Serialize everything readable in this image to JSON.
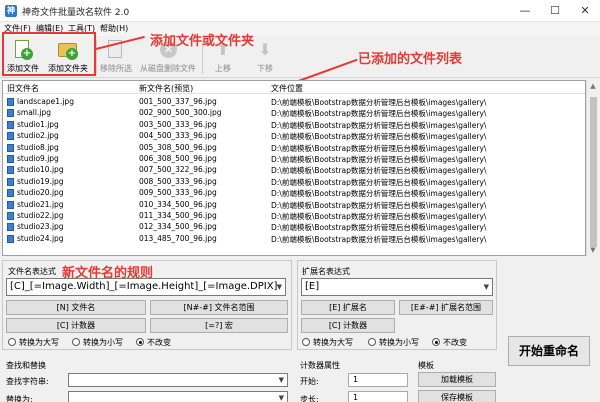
{
  "window": {
    "title": "神奇文件批量改名软件 2.0",
    "app_icon": "神",
    "min_glyph": "—",
    "max_glyph": "☐",
    "close_glyph": "✕"
  },
  "menu": [
    "文件(F)",
    "编辑(E)",
    "工具(T)",
    "帮助(H)"
  ],
  "toolbar": {
    "add_file": "添加文件",
    "add_folder": "添加文件夹",
    "remove_selected": "移除所选",
    "delete_from_disk": "从磁盘删除文件",
    "move_up": "上移",
    "move_down": "下移"
  },
  "annotations": {
    "toolbar_note": "添加文件或文件夹",
    "list_note": "已添加的文件列表",
    "rule_note": "新文件名的规则"
  },
  "file_list": {
    "columns": [
      "旧文件名",
      "新文件名(预览)",
      "文件位置"
    ],
    "rows": [
      [
        "landscape1.jpg",
        "001_500_337_96.jpg",
        "D:\\前端模板\\Bootstrap数据分析管理后台模板\\images\\gallery\\"
      ],
      [
        "small.jpg",
        "002_900_500_300.jpg",
        "D:\\前端模板\\Bootstrap数据分析管理后台模板\\images\\gallery\\"
      ],
      [
        "studio1.jpg",
        "003_500_333_96.jpg",
        "D:\\前端模板\\Bootstrap数据分析管理后台模板\\images\\gallery\\"
      ],
      [
        "studio2.jpg",
        "004_500_333_96.jpg",
        "D:\\前端模板\\Bootstrap数据分析管理后台模板\\images\\gallery\\"
      ],
      [
        "studio8.jpg",
        "005_308_500_96.jpg",
        "D:\\前端模板\\Bootstrap数据分析管理后台模板\\images\\gallery\\"
      ],
      [
        "studio9.jpg",
        "006_308_500_96.jpg",
        "D:\\前端模板\\Bootstrap数据分析管理后台模板\\images\\gallery\\"
      ],
      [
        "studio10.jpg",
        "007_500_322_96.jpg",
        "D:\\前端模板\\Bootstrap数据分析管理后台模板\\images\\gallery\\"
      ],
      [
        "studio19.jpg",
        "008_500_333_96.jpg",
        "D:\\前端模板\\Bootstrap数据分析管理后台模板\\images\\gallery\\"
      ],
      [
        "studio20.jpg",
        "009_500_333_96.jpg",
        "D:\\前端模板\\Bootstrap数据分析管理后台模板\\images\\gallery\\"
      ],
      [
        "studio21.jpg",
        "010_334_500_96.jpg",
        "D:\\前端模板\\Bootstrap数据分析管理后台模板\\images\\gallery\\"
      ],
      [
        "studio22.jpg",
        "011_334_500_96.jpg",
        "D:\\前端模板\\Bootstrap数据分析管理后台模板\\images\\gallery\\"
      ],
      [
        "studio23.jpg",
        "012_334_500_96.jpg",
        "D:\\前端模板\\Bootstrap数据分析管理后台模板\\images\\gallery\\"
      ],
      [
        "studio24.jpg",
        "013_485_700_96.jpg",
        "D:\\前端模板\\Bootstrap数据分析管理后台模板\\images\\gallery\\"
      ]
    ]
  },
  "filename_rule": {
    "label": "文件名表达式",
    "expression": "[C]_[=Image.Width]_[=Image.Height]_[=Image.DPIX]",
    "buttons": [
      "[N] 文件名",
      "[N#-#] 文件名范围",
      "[C] 计数器",
      "[=?] 宏"
    ],
    "radios": [
      "转换为大写",
      "转换为小写",
      "不改变"
    ],
    "selected_radio": 2
  },
  "ext_rule": {
    "label": "扩展名表达式",
    "expression": "[E]",
    "buttons": [
      "[E] 扩展名",
      "[E#-#] 扩展名范围",
      "[C] 计数器"
    ],
    "radios": [
      "转换为大写",
      "转换为小写",
      "不改变"
    ],
    "selected_radio": 2
  },
  "start_button": "开始重命名",
  "find_replace": {
    "title": "查找和替换",
    "find_label": "查找字符串:",
    "replace_label": "替换为:"
  },
  "counter": {
    "title": "计数器属性",
    "start_label": "开始:",
    "start_value": "1",
    "step_label": "步长:",
    "step_value": "1"
  },
  "template": {
    "title": "模板",
    "load": "加载模板",
    "save": "保存模板"
  },
  "colors": {
    "annotation_red": "#e53935",
    "icon_blue": "#3c7fd4",
    "add_green": "#3aa631"
  }
}
